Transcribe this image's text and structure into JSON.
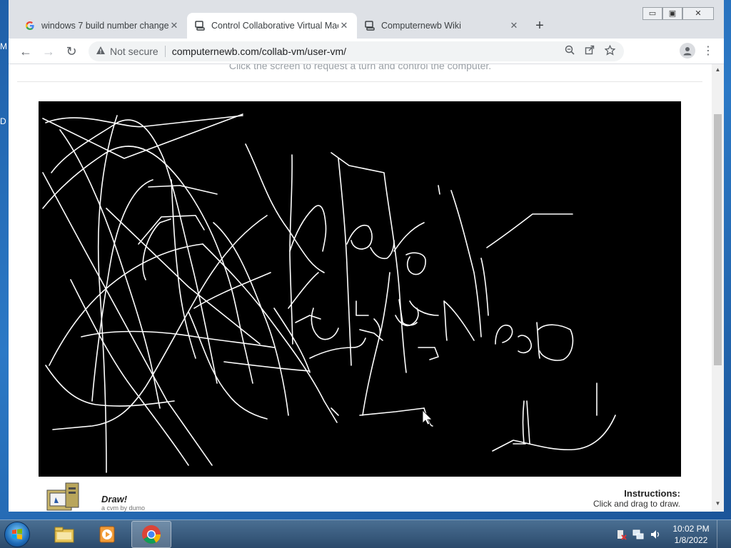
{
  "desktop": {
    "edge_labels": [
      "M",
      "D"
    ]
  },
  "window": {
    "controls": {
      "minimize": "▭",
      "restore": "▣",
      "close": "✕"
    }
  },
  "tabs": [
    {
      "label": "windows 7 build number change",
      "icon": "google-icon",
      "close": "✕",
      "active": false
    },
    {
      "label": "Control Collaborative Virtual Mac",
      "icon": "computer-icon",
      "close": "✕",
      "active": true
    },
    {
      "label": "Computernewb Wiki",
      "icon": "computer-icon",
      "close": "✕",
      "active": false
    }
  ],
  "new_tab_label": "+",
  "toolbar": {
    "back": "←",
    "forward": "→",
    "reload": "↻",
    "security_label": "Not secure",
    "security_icon": "warning-icon",
    "url": "computernewb.com/collab-vm/user-vm/",
    "icons": [
      "zoom-icon",
      "share-icon",
      "bookmark-star-icon"
    ],
    "menu": "⋮"
  },
  "page": {
    "top_hint": "Click the screen to request a turn and control the computer.",
    "footer_title": "Draw!",
    "footer_subtitle": "a cvm by dumo",
    "instructions_title": "Instructions:",
    "instructions_text": "Click and drag to draw."
  },
  "scrollbar": {
    "up": "▲",
    "down": "▼"
  },
  "taskbar": {
    "items": [
      "file-explorer-icon",
      "media-player-icon",
      "chrome-icon"
    ],
    "tray_icons": [
      "action-center-icon",
      "network-icon",
      "volume-icon"
    ],
    "time": "10:02 PM",
    "date": "1/8/2022"
  },
  "colors": {
    "tab_strip": "#dee1e6",
    "toolbar": "#ffffff",
    "vm_background": "#000000",
    "drawing_stroke": "#ffffff",
    "taskbar": "#2b4a6c"
  }
}
